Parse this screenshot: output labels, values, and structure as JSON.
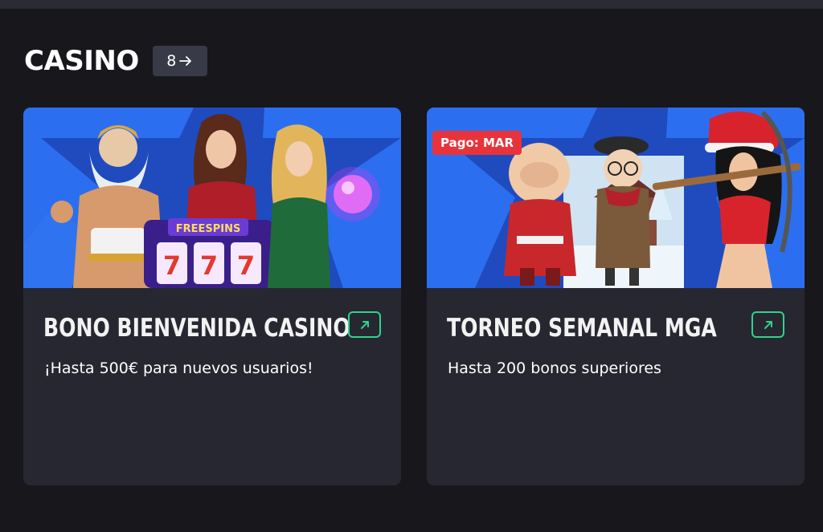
{
  "section": {
    "title": "CASINO",
    "count": "8"
  },
  "cards": [
    {
      "title": "BONO BIENVENIDA CASINO",
      "description": "¡Hasta 500€ para nuevos usuarios!",
      "banner_text": "FREESPINS",
      "reels": [
        "7",
        "7",
        "7"
      ]
    },
    {
      "title": "TORNEO SEMANAL MGA",
      "description": "Hasta 200 bonos superiores",
      "tag": "Pago: MAR"
    }
  ],
  "colors": {
    "background": "#17171c",
    "card": "#272732",
    "badge": "#383a48",
    "accent_green": "#2ed48b",
    "tag_red": "#e8333b",
    "banner_blue": "#2b6ff0"
  },
  "icons": {
    "count_arrow": "arrow-right-icon",
    "external_link": "external-link-icon"
  }
}
